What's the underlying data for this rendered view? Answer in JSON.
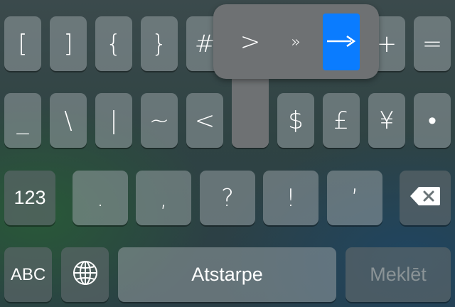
{
  "row1": [
    "[",
    "]",
    "{",
    "}",
    "#",
    "%",
    "^",
    "*",
    "+",
    "="
  ],
  "row2": [
    "_",
    "\\",
    "|",
    "~",
    "<",
    ">",
    "$",
    "£",
    "¥",
    "•"
  ],
  "row3": {
    "toggle_label": "123",
    "keys": [
      ".",
      ",",
      "?",
      "!",
      "’"
    ],
    "backspace_icon": "backspace-icon"
  },
  "row4": {
    "abc_label": "ABC",
    "globe_icon": "globe-icon",
    "space_label": "Atstarpe",
    "search_label": "Meklēt"
  },
  "popup": {
    "options": [
      ">",
      "»",
      "→"
    ],
    "selected_index": 2
  },
  "colors": {
    "selected": "#0a7cff",
    "popup": "#6e7173"
  }
}
